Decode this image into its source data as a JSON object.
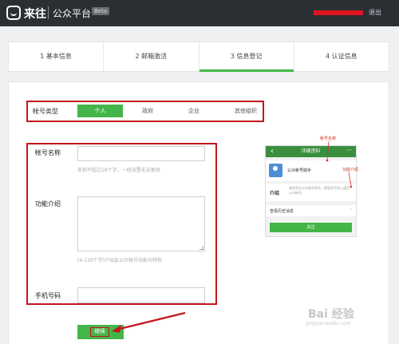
{
  "header": {
    "app_name": "来往",
    "platform_name": "公众平台",
    "beta": "Beta",
    "logout": "退出"
  },
  "steps": [
    {
      "label": "1 基本信息"
    },
    {
      "label": "2 邮箱激活"
    },
    {
      "label": "3 信息登记"
    },
    {
      "label": "4 认证信息"
    }
  ],
  "account_type": {
    "label": "帐号类型",
    "options": [
      "个人",
      "政府",
      "企业",
      "其他组织"
    ],
    "selected": "个人"
  },
  "form": {
    "name_label": "帐号名称",
    "name_hint": "名称不超过18个字，一经设置无法更改",
    "intro_label": "功能介绍",
    "intro_hint": "(4-120个字)介绍此公众帐号功能与特色",
    "phone_label": "手机号码"
  },
  "continue_button": "继续",
  "preview": {
    "title": "详细资料",
    "account_name": "公众帐号助手",
    "intro_label": "介绍",
    "intro_text": "来往官方公众帐号助手，帮您在手机上使用公众帐号",
    "history": "查看历史消息",
    "follow": "关注",
    "annotation_name": "帐号名称",
    "annotation_intro": "功能介绍"
  },
  "watermark": {
    "brand": "Bai 经验",
    "url": "jingyan.baidu.com"
  },
  "colors": {
    "accent": "#44b549",
    "highlight": "#c3161c",
    "header_bg": "#2b2e33"
  }
}
